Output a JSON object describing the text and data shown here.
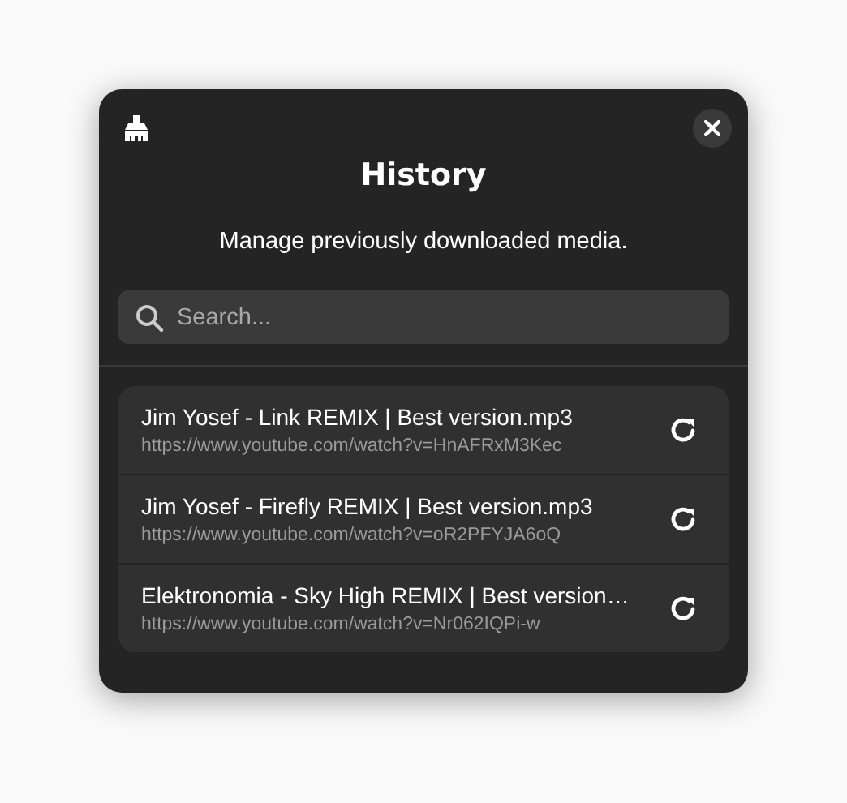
{
  "dialog": {
    "title": "History",
    "subtitle": "Manage previously downloaded media."
  },
  "search": {
    "placeholder": "Search..."
  },
  "items": [
    {
      "title": "Jim Yosef - Link REMIX | Best version.mp3",
      "url": "https://www.youtube.com/watch?v=HnAFRxM3Kec"
    },
    {
      "title": "Jim Yosef - Firefly REMIX | Best version.mp3",
      "url": "https://www.youtube.com/watch?v=oR2PFYJA6oQ"
    },
    {
      "title": "Elektronomia - Sky High REMIX | Best version…",
      "url": "https://www.youtube.com/watch?v=Nr062IQPi-w"
    }
  ]
}
